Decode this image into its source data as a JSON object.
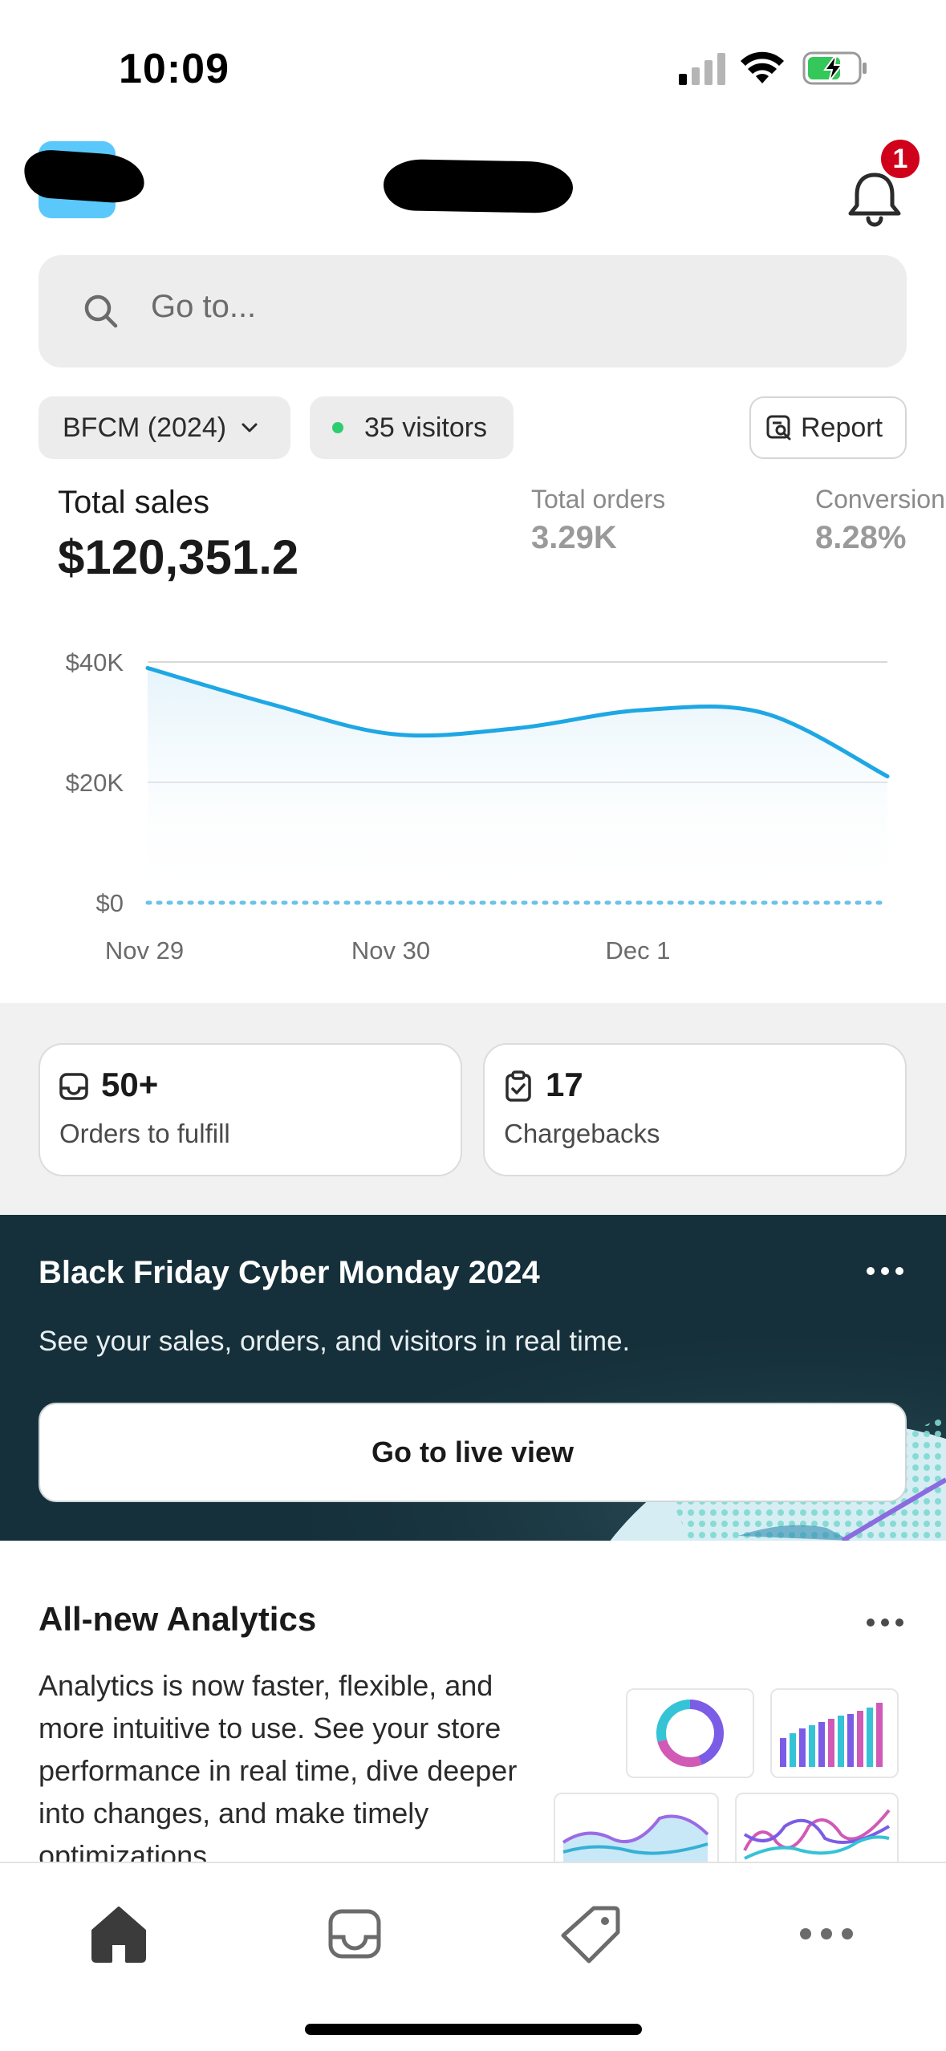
{
  "status_bar": {
    "time": "10:09"
  },
  "header": {
    "notification_count": "1"
  },
  "search": {
    "placeholder": "Go to..."
  },
  "filters": {
    "date_range": "BFCM (2024)",
    "visitors": "35 visitors",
    "report_label": "Report"
  },
  "metrics": {
    "total_sales_label": "Total sales",
    "total_sales_value": "$120,351.2",
    "total_orders_label": "Total orders",
    "total_orders_value": "3.29K",
    "conversion_label": "Conversion",
    "conversion_value": "8.28%"
  },
  "chart_data": {
    "type": "line",
    "x": [
      "Nov 29",
      "",
      "Nov 30",
      "",
      "Dec 1",
      "",
      ""
    ],
    "x_tick_labels": [
      "Nov 29",
      "Nov 30",
      "Dec 1"
    ],
    "y_tick_labels": [
      "$40K",
      "$20K",
      "$0"
    ],
    "ylim": [
      0,
      40000
    ],
    "series": [
      {
        "values": [
          39000,
          33000,
          28000,
          29000,
          32000,
          31500,
          21000
        ],
        "color": "#1ea7e4"
      },
      {
        "values": [
          0,
          0,
          0,
          0,
          0,
          0,
          0
        ],
        "style": "dotted",
        "color": "#6cc3e8"
      }
    ],
    "grid": true
  },
  "stats": {
    "orders_value": "50+",
    "orders_label": "Orders to fulfill",
    "chargebacks_value": "17",
    "chargebacks_label": "Chargebacks"
  },
  "bfcm": {
    "title": "Black Friday Cyber Monday 2024",
    "description": "See your sales, orders, and visitors in real time.",
    "button_label": "Go to live view"
  },
  "analytics_card": {
    "title": "All-new Analytics",
    "body": "Analytics is now faster, flexible, and more intuitive to use. See your store performance in real time, dive deeper into changes, and make timely optimizations."
  },
  "nav": {
    "items": [
      "home-icon",
      "orders-icon",
      "products-icon",
      "more-icon"
    ]
  },
  "colors": {
    "accent_line": "#1ea7e4",
    "badge_red": "#d0021b",
    "banner_bg": "#15303a",
    "live_dot": "#2ecc71"
  }
}
